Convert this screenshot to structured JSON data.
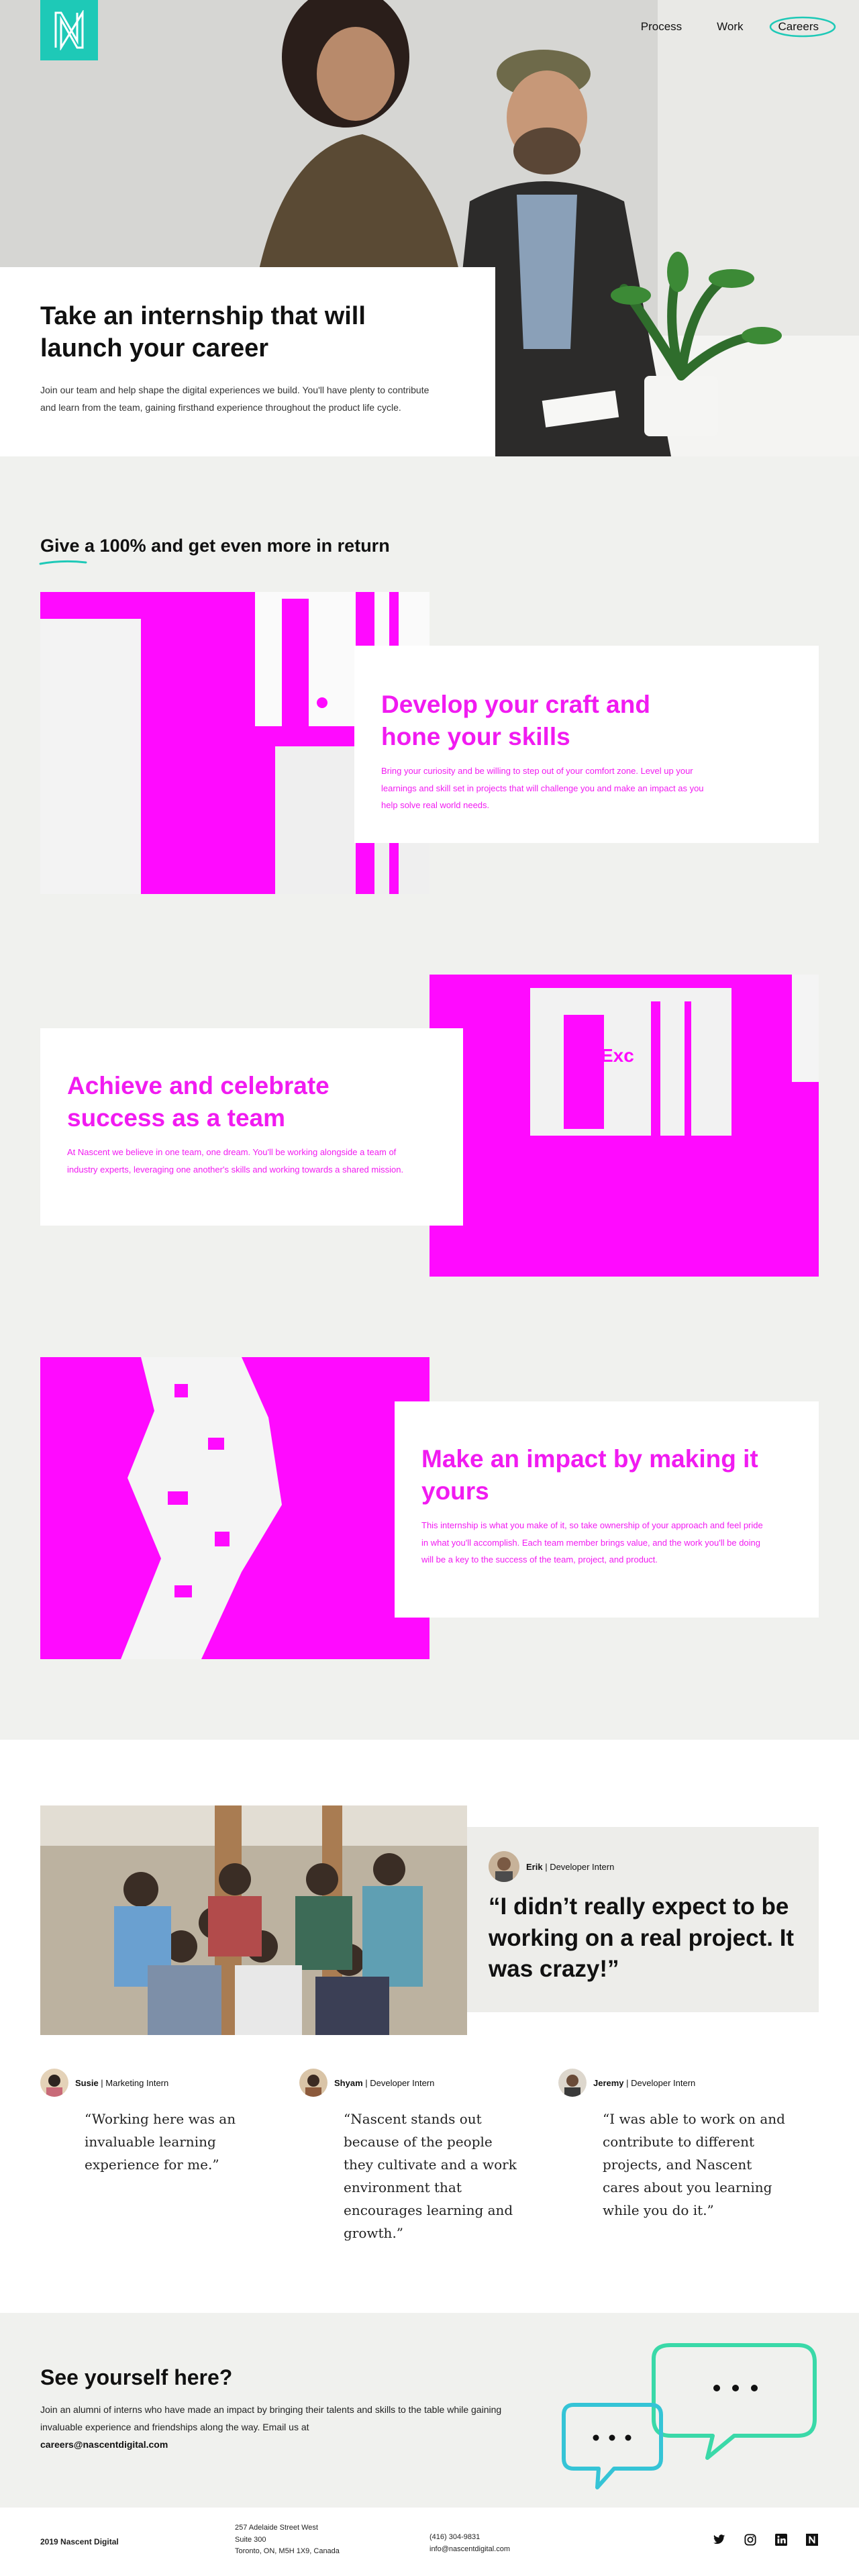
{
  "nav": {
    "items": [
      "Process",
      "Work",
      "Careers"
    ],
    "active": "Careers",
    "accent": "#1ec9b7"
  },
  "hero": {
    "title": "Take an internship that will launch your career",
    "body": "Join our team and help shape the digital experiences we build. You'll have plenty to contribute and learn from the team, gaining firsthand experience throughout the product life cycle."
  },
  "give": {
    "heading": "Give a 100% and get even more in return",
    "features": [
      {
        "title": "Develop your craft and hone your skills",
        "body": "Bring your curiosity and be willing to step out of your comfort zone. Level up your learnings and skill set in projects that will challenge you and make an impact as you help solve real world needs."
      },
      {
        "title": "Achieve and celebrate success as a team",
        "body": "At Nascent we believe in one team, one dream. You'll be working alongside a team of industry experts, leveraging one another's skills and working towards a shared mission."
      },
      {
        "title": "Make an impact by making it yours",
        "body": "This internship is what you make of it, so take ownership of your approach and feel pride in what you'll accomplish. Each team member brings value, and the work you'll be doing will be a key to the success of the team, project, and product."
      }
    ],
    "accent": "#ff0aff"
  },
  "testimonials": {
    "main": {
      "name": "Erik",
      "role": "Developer Intern",
      "quote": "“I didn’t really expect to be working on a real project. It was crazy!”"
    },
    "others": [
      {
        "name": "Susie",
        "role": "Marketing Intern",
        "quote": "“Working here was an invaluable learning experience for me.”"
      },
      {
        "name": "Shyam",
        "role": "Developer Intern",
        "quote": "“Nascent stands out because of the people they cultivate and a work environment that encourages learning and growth.”"
      },
      {
        "name": "Jeremy",
        "role": "Developer Intern",
        "quote": "“I was able to work on and contribute to different projects, and Nascent cares about you learning while you do it.”"
      }
    ]
  },
  "cta": {
    "heading": "See yourself here?",
    "body": "Join an alumni of interns who have made an impact by bringing their talents and skills to the table while gaining invaluable experience and friendships along the way. Email us at",
    "email": "careers@nascentdigital.com",
    "bubble_colors": [
      "#3ad9a8",
      "#35c4d6"
    ]
  },
  "footer": {
    "brand": "2019 Nascent Digital",
    "address": [
      "257 Adelaide Street West",
      "Suite 300",
      "Toronto, ON, M5H 1X9, Canada"
    ],
    "phone": "(416) 304-9831",
    "email": "info@nascentdigital.com",
    "social": [
      "twitter-icon",
      "instagram-icon",
      "linkedin-icon",
      "nascent-icon"
    ]
  }
}
